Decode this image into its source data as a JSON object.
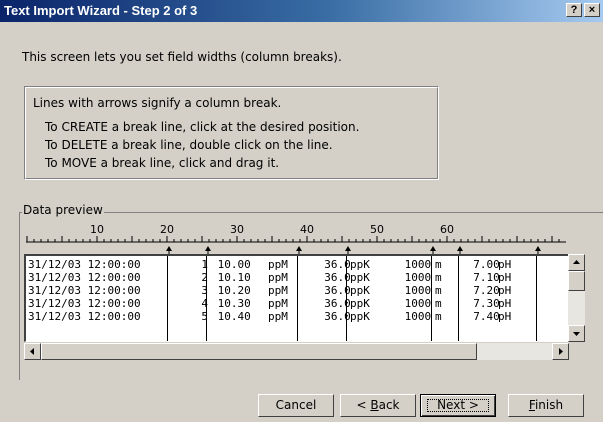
{
  "window": {
    "title": "Text Import Wizard - Step 2 of 3",
    "help_label": "?",
    "close_label": "×"
  },
  "intro": "This screen lets you set field widths (column breaks).",
  "info": {
    "line1": "Lines with arrows signify a column break.",
    "line2": "To CREATE a break line, click at the desired position.",
    "line3": "To DELETE a break line, double click on the line.",
    "line4": "To MOVE a break line, click and drag it."
  },
  "preview": {
    "label": "Data preview",
    "ruler_labels": [
      "10",
      "20",
      "30",
      "40",
      "50",
      "60"
    ],
    "rows": [
      [
        "31/12/03 12:00:00",
        "1",
        " 10.00",
        "ppM",
        "  36.0",
        "ppK",
        " 1000",
        "m",
        "  7.00",
        "pH"
      ],
      [
        "31/12/03 12:00:00",
        "2",
        " 10.10",
        "ppM",
        "  36.0",
        "ppK",
        " 1000",
        "m",
        "  7.10",
        "pH"
      ],
      [
        "31/12/03 12:00:00",
        "3",
        " 10.20",
        "ppM",
        "  36.0",
        "ppK",
        " 1000",
        "m",
        "  7.20",
        "pH"
      ],
      [
        "31/12/03 12:00:00",
        "4",
        " 10.30",
        "ppM",
        "  36.0",
        "ppK",
        " 1000",
        "m",
        "  7.30",
        "pH"
      ],
      [
        "31/12/03 12:00:00",
        "5",
        " 10.40",
        "ppM",
        "  36.0",
        "ppK",
        " 1000",
        "m",
        "  7.40",
        "pH"
      ]
    ]
  },
  "buttons": {
    "cancel": "Cancel",
    "back_prefix": "< ",
    "back_key": "B",
    "back_rest": "ack",
    "next": "Next >",
    "finish_key": "F",
    "finish_rest": "inish"
  }
}
